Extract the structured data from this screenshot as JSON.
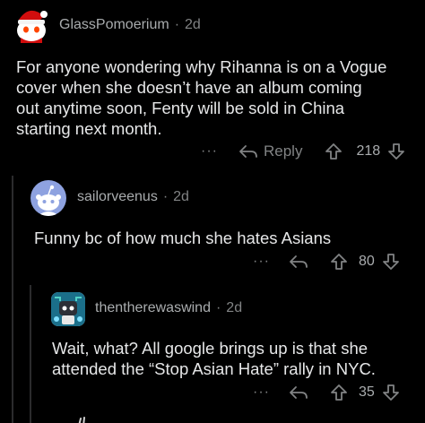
{
  "comments": [
    {
      "username": "GlassPomoerium",
      "separator": "·",
      "age": "2d",
      "body": "For anyone wondering why Rihanna is on a Vogue\ncover when she doesn’t have an album coming\nout anytime soon, Fenty will be sold in China\nstarting next month.",
      "more": "···",
      "reply_label": "Reply",
      "score": "218"
    },
    {
      "username": "sailorveenus",
      "separator": "·",
      "age": "2d",
      "body": "Funny bc of how much she hates Asians",
      "more": "···",
      "score": "80"
    },
    {
      "username": "thentherewaswind",
      "separator": "·",
      "age": "2d",
      "body": "Wait, what? All google brings up is that she\nattended the “Stop Asian Hate” rally in NYC.",
      "more": "···",
      "score": "35"
    }
  ],
  "colors": {
    "background": "#000000",
    "text": "#e6e7e8",
    "muted": "#818384",
    "thread_line": "#2b2b2d"
  }
}
